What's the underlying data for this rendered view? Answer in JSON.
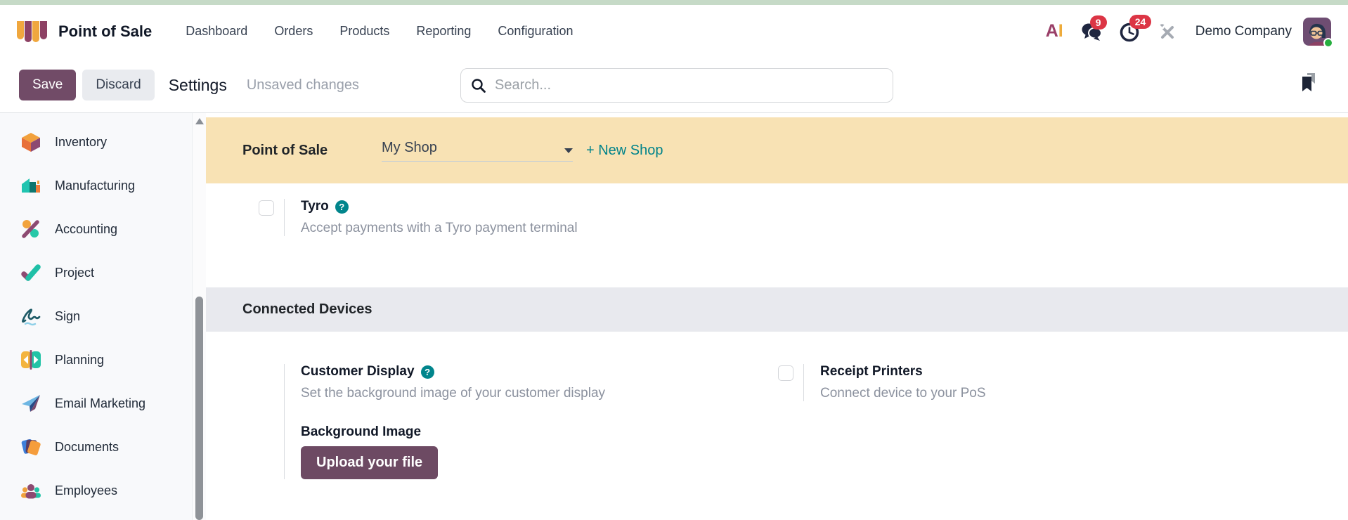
{
  "topbar": {
    "app_name": "Point of Sale",
    "menu": [
      {
        "label": "Dashboard"
      },
      {
        "label": "Orders"
      },
      {
        "label": "Products"
      },
      {
        "label": "Reporting"
      },
      {
        "label": "Configuration"
      }
    ],
    "icons": [
      "odoo-ai-icon",
      "messages-icon",
      "activities-clock-icon",
      "tools-icon",
      "avatar"
    ],
    "messages_badge": "9",
    "activities_badge": "24",
    "company": "Demo Company"
  },
  "control_bar": {
    "save_label": "Save",
    "discard_label": "Discard",
    "title": "Settings",
    "status": "Unsaved changes",
    "search_placeholder": "Search...",
    "icons": [
      "search-icon",
      "bookmark-icon"
    ]
  },
  "sidebar": {
    "items": [
      {
        "label": "Inventory",
        "icon": "inventory-cube-icon"
      },
      {
        "label": "Manufacturing",
        "icon": "manufacturing-icon"
      },
      {
        "label": "Accounting",
        "icon": "accounting-percent-icon"
      },
      {
        "label": "Project",
        "icon": "project-check-icon"
      },
      {
        "label": "Sign",
        "icon": "sign-signature-icon"
      },
      {
        "label": "Planning",
        "icon": "planning-icon"
      },
      {
        "label": "Email Marketing",
        "icon": "paper-plane-icon"
      },
      {
        "label": "Documents",
        "icon": "documents-icon"
      },
      {
        "label": "Employees",
        "icon": "employees-icon"
      }
    ]
  },
  "settings": {
    "shop_banner": {
      "label": "Point of Sale",
      "shop_name": "My Shop",
      "new_shop_label": "+ New Shop"
    },
    "tyro": {
      "title": "Tyro",
      "description": "Accept payments with a Tyro payment terminal",
      "checked": false
    },
    "section_title": "Connected Devices",
    "customer_display": {
      "title": "Customer Display",
      "description": "Set the background image of your customer display",
      "field_label": "Background Image",
      "upload_label": "Upload your file"
    },
    "receipt_printers": {
      "title": "Receipt Printers",
      "description": "Connect device to your PoS",
      "checked": false
    }
  },
  "colors": {
    "accent_purple": "#714b67",
    "teal_link": "#00838a",
    "banner_bg": "#f8e2b4",
    "section_band_bg": "#e8e9ee",
    "badge_red": "#dc3545",
    "top_strip_green": "#c6dac7"
  }
}
